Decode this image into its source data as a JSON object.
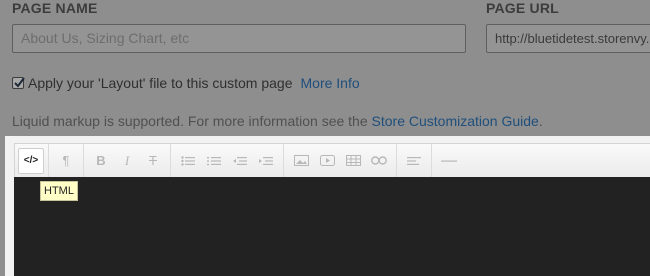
{
  "fields": {
    "page_name_label": "PAGE NAME",
    "page_name_placeholder": "About Us, Sizing Chart, etc",
    "page_url_label": "PAGE URL",
    "page_url_value": "http://bluetidetest.storenvy."
  },
  "layout_option": {
    "checked": true,
    "label": "Apply your 'Layout' file to this custom page",
    "more_info": "More Info"
  },
  "help": {
    "text": "Liquid markup is supported. For more information see the ",
    "link": "Store Customization Guide",
    "suffix": "."
  },
  "toolbar": {
    "html_label": "</>",
    "tooltip": "HTML",
    "buttons": [
      "html",
      "paragraph",
      "bold",
      "italic",
      "strikethrough",
      "unordered-list",
      "ordered-list",
      "outdent",
      "indent",
      "image",
      "video",
      "table",
      "link",
      "align",
      "horizontal-rule"
    ]
  }
}
